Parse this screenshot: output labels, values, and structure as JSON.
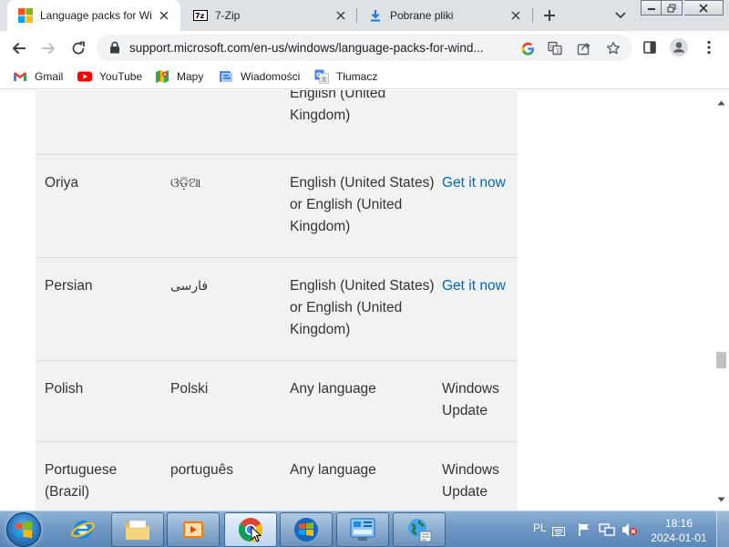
{
  "tabs": [
    {
      "title": "Language packs for Win",
      "active": true,
      "icon": "microsoft-logo-icon"
    },
    {
      "title": "7-Zip",
      "active": false,
      "icon": "7zip-icon"
    },
    {
      "title": "Pobrane pliki",
      "active": false,
      "icon": "download-icon"
    }
  ],
  "address": {
    "url": "support.microsoft.com/en-us/windows/language-packs-for-wind..."
  },
  "bookmarks": [
    {
      "label": "Gmail",
      "icon": "gmail-icon"
    },
    {
      "label": "YouTube",
      "icon": "youtube-icon"
    },
    {
      "label": "Mapy",
      "icon": "maps-icon"
    },
    {
      "label": "Wiadomości",
      "icon": "news-icon"
    },
    {
      "label": "Tłumacz",
      "icon": "translate-icon"
    }
  ],
  "table": {
    "rows": [
      {
        "language": "",
        "native": "",
        "required": "English (United Kingdom)",
        "how": ""
      },
      {
        "language": "Oriya",
        "native": "ଓଡ଼ିଆ",
        "required": "English (United States) or English (United Kingdom)",
        "how": "Get it now",
        "how_is_link": true
      },
      {
        "language": "Persian",
        "native": "فارسی",
        "required": "English (United States) or English (United Kingdom)",
        "how": "Get it now",
        "how_is_link": true
      },
      {
        "language": "Polish",
        "native": "Polski",
        "required": "Any language",
        "how": "Windows Update",
        "how_is_link": false
      },
      {
        "language": "Portuguese (Brazil)",
        "native": "português",
        "required": "Any language",
        "how": "Windows Update",
        "how_is_link": false
      }
    ]
  },
  "scrollbar": {
    "position_fraction": 0.63
  },
  "taskbar": {
    "apps": [
      {
        "name": "Internet Explorer",
        "icon": "internet-explorer-icon"
      },
      {
        "name": "Explorer",
        "icon": "folder-icon"
      },
      {
        "name": "Media Player",
        "icon": "media-player-icon"
      },
      {
        "name": "Chrome",
        "icon": "chrome-icon"
      },
      {
        "name": "Windows",
        "icon": "windows-logo-icon"
      },
      {
        "name": "Control Panel",
        "icon": "control-panel-icon"
      },
      {
        "name": "Network",
        "icon": "network-globe-icon"
      }
    ],
    "language": "PL",
    "time": "18:16",
    "date": "2024-01-01"
  },
  "colors": {
    "link": "#0067b8",
    "table_bg": "#f2f2f2",
    "tab_strip": "#dee1e6"
  }
}
